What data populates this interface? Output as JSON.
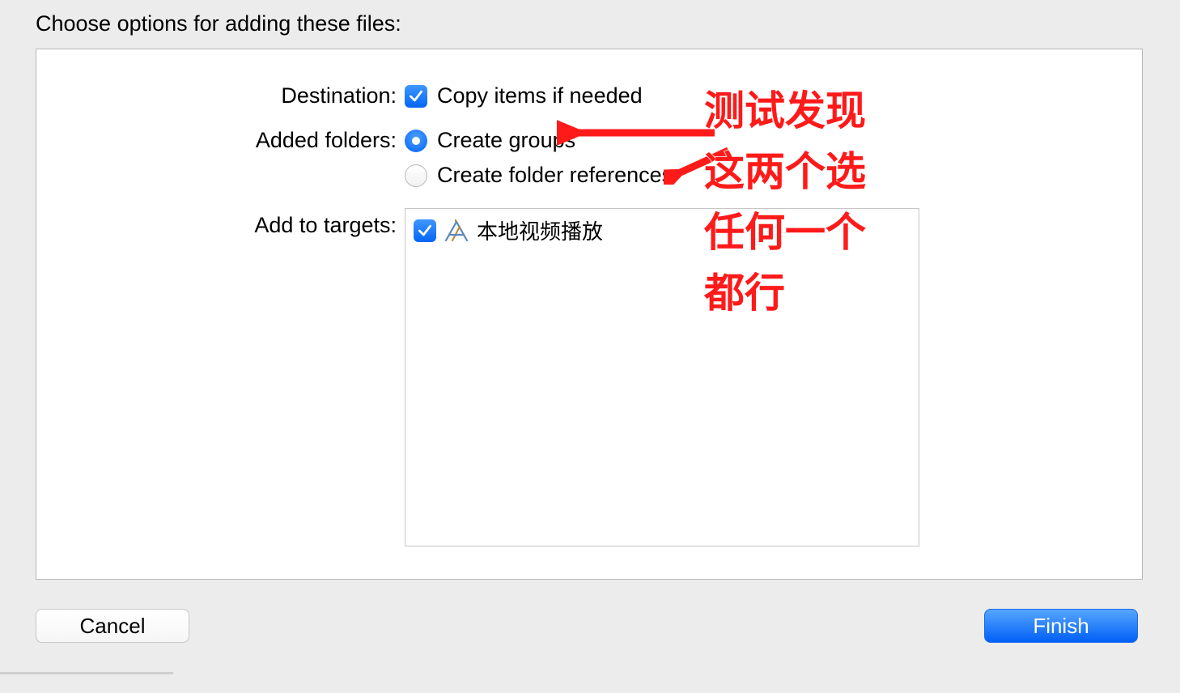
{
  "header": "Choose options for adding these files:",
  "labels": {
    "destination": "Destination:",
    "added_folders": "Added folders:",
    "add_to_targets": "Add to targets:"
  },
  "options": {
    "copy_items": "Copy items if needed",
    "create_groups": "Create groups",
    "create_folder_refs": "Create folder references"
  },
  "targets": [
    {
      "name": "本地视频播放",
      "checked": true
    }
  ],
  "buttons": {
    "cancel": "Cancel",
    "finish": "Finish"
  },
  "annotation": {
    "line1": "测试发现",
    "line2": "这两个选",
    "line3": "任何一个",
    "line4": "都行"
  },
  "colors": {
    "accent": "#0565f6",
    "annotation": "#ff1a1a"
  }
}
